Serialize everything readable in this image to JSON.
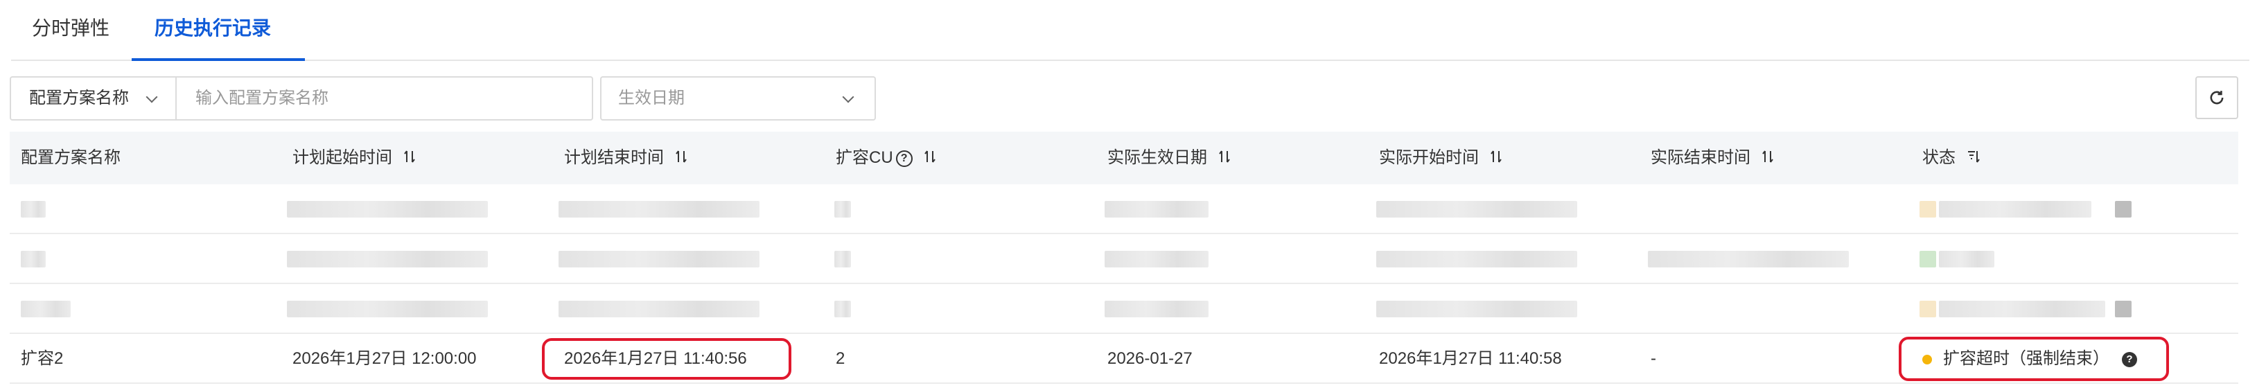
{
  "tabs": [
    {
      "label": "分时弹性",
      "active": false
    },
    {
      "label": "历史执行记录",
      "active": true
    }
  ],
  "filters": {
    "field_select": "配置方案名称",
    "name_placeholder": "输入配置方案名称",
    "date_placeholder": "生效日期"
  },
  "table": {
    "columns": [
      "配置方案名称",
      "计划起始时间",
      "计划结束时间",
      "扩容CU",
      "实际生效日期",
      "实际开始时间",
      "实际结束时间",
      "状态"
    ],
    "last_row": {
      "name": "扩容2",
      "plan_start": "2026年1月27日 12:00:00",
      "plan_end": "2026年1月27日 11:40:56",
      "cu": "2",
      "effective_date": "2026-01-27",
      "actual_start": "2026年1月27日 11:40:58",
      "actual_end": "-",
      "status": "扩容超时（强制结束）"
    }
  },
  "colors": {
    "accent": "#0f5bd8",
    "status_warning": "#f5b50a",
    "highlight_box": "#e0182d"
  }
}
